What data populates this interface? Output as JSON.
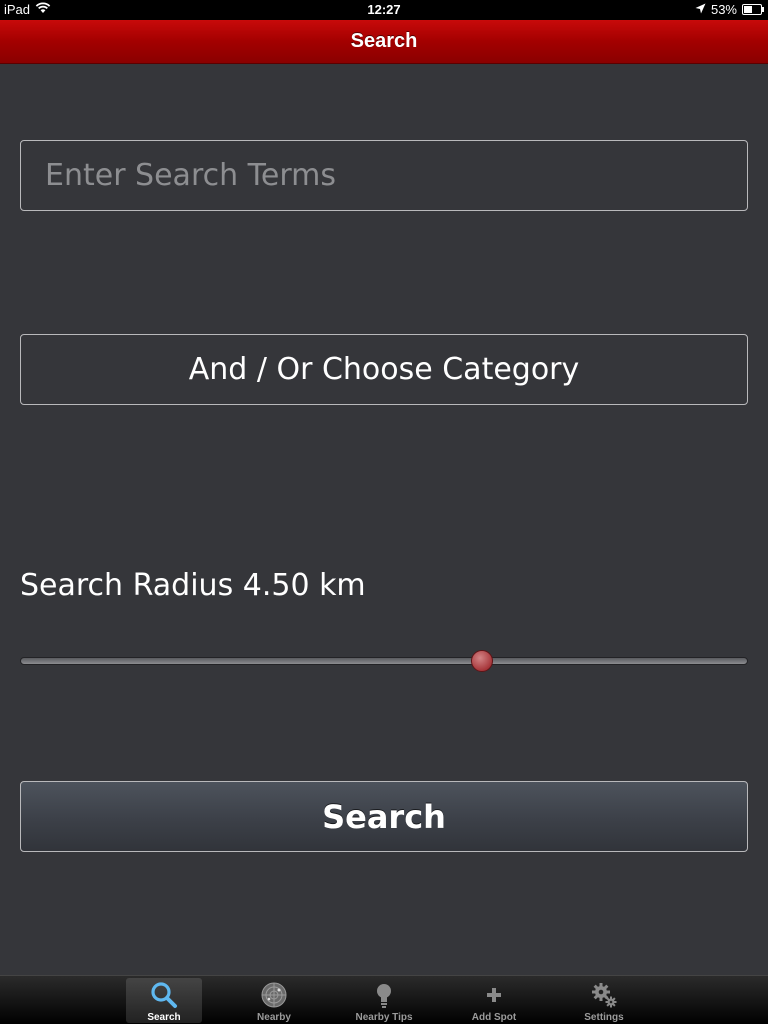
{
  "status_bar": {
    "device": "iPad",
    "time": "12:27",
    "battery": "53%",
    "battery_level": 0.53,
    "wifi_icon": "wifi-icon",
    "location_icon": "location-arrow-icon"
  },
  "nav": {
    "title": "Search",
    "color": "#a30000"
  },
  "search": {
    "placeholder": "Enter Search Terms",
    "value": ""
  },
  "category": {
    "label": "And / Or Choose Category"
  },
  "radius": {
    "label": "Search Radius 4.50 km",
    "slider_position": 0.634,
    "thumb_color": "#a7373b"
  },
  "search_button": {
    "label": "Search"
  },
  "tab_bar": {
    "tabs": [
      {
        "label": "Search",
        "icon": "magnifier-icon",
        "selected": true
      },
      {
        "label": "Nearby",
        "icon": "radar-icon",
        "selected": false
      },
      {
        "label": "Nearby Tips",
        "icon": "lightbulb-icon",
        "selected": false
      },
      {
        "label": "Add Spot",
        "icon": "plus-icon",
        "selected": false
      },
      {
        "label": "Settings",
        "icon": "gears-icon",
        "selected": false
      }
    ]
  }
}
